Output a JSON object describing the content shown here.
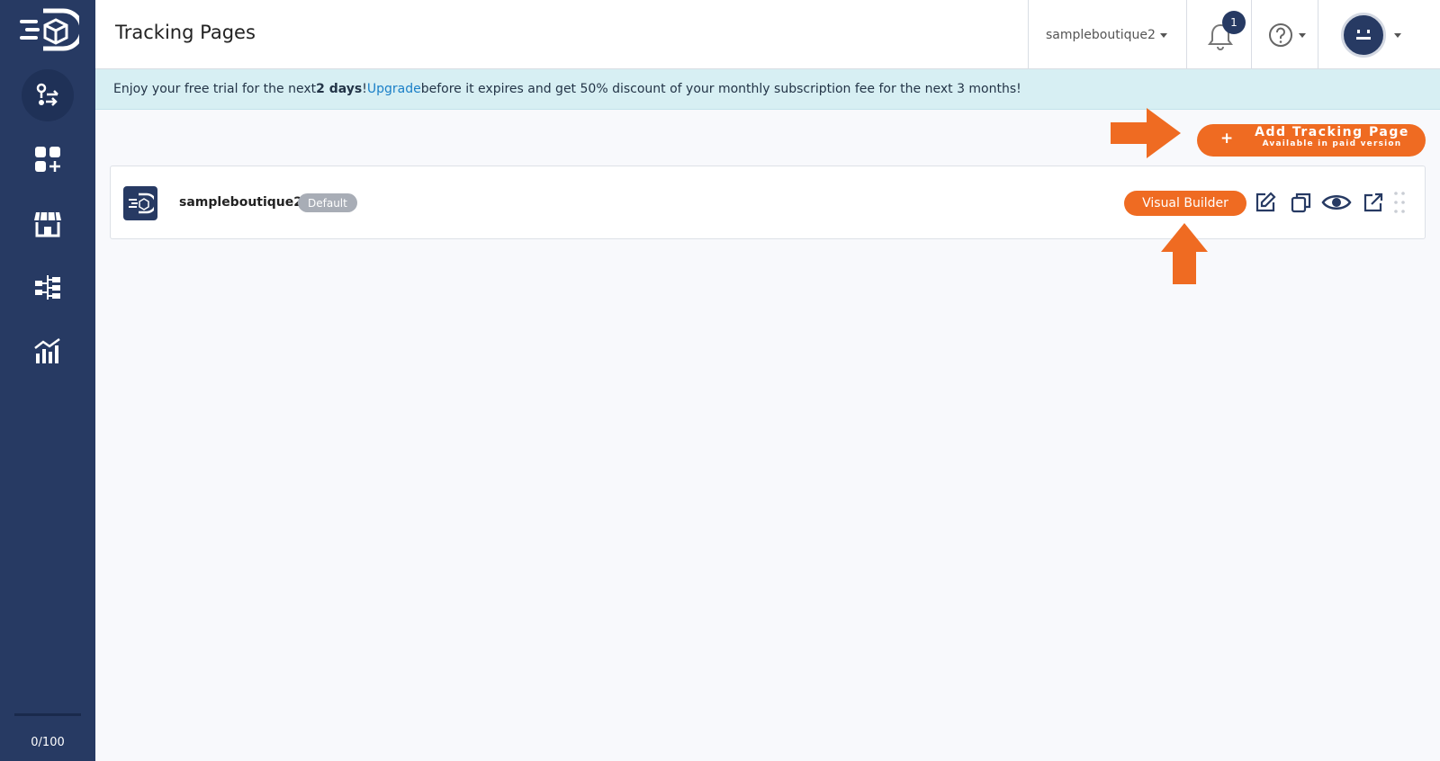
{
  "header": {
    "title": "Tracking Pages",
    "store_name": "sampleboutique2",
    "notification_count": "1"
  },
  "banner": {
    "text_before": "Enjoy your free trial for the next ",
    "days": "2 days",
    "exclaim": "!",
    "link": "Upgrade",
    "text_after": " before it expires and get 50% discount of your monthly subscription fee for the next 3 months!"
  },
  "add_button": {
    "plus": "+",
    "title": "Add Tracking Page",
    "subtitle": "Available in paid version"
  },
  "tracking_page": {
    "name": "sampleboutique2",
    "badge": "Default",
    "visual_builder_label": "Visual Builder"
  },
  "sidebar": {
    "items": [
      "shipments-icon",
      "add-apps-icon",
      "store-icon",
      "workflow-icon",
      "analytics-icon"
    ],
    "usage": "0/100"
  },
  "colors": {
    "sidebar": "#273a63",
    "accent": "#ef6b22",
    "banner": "#d7eff3",
    "link": "#1a7fc7"
  }
}
